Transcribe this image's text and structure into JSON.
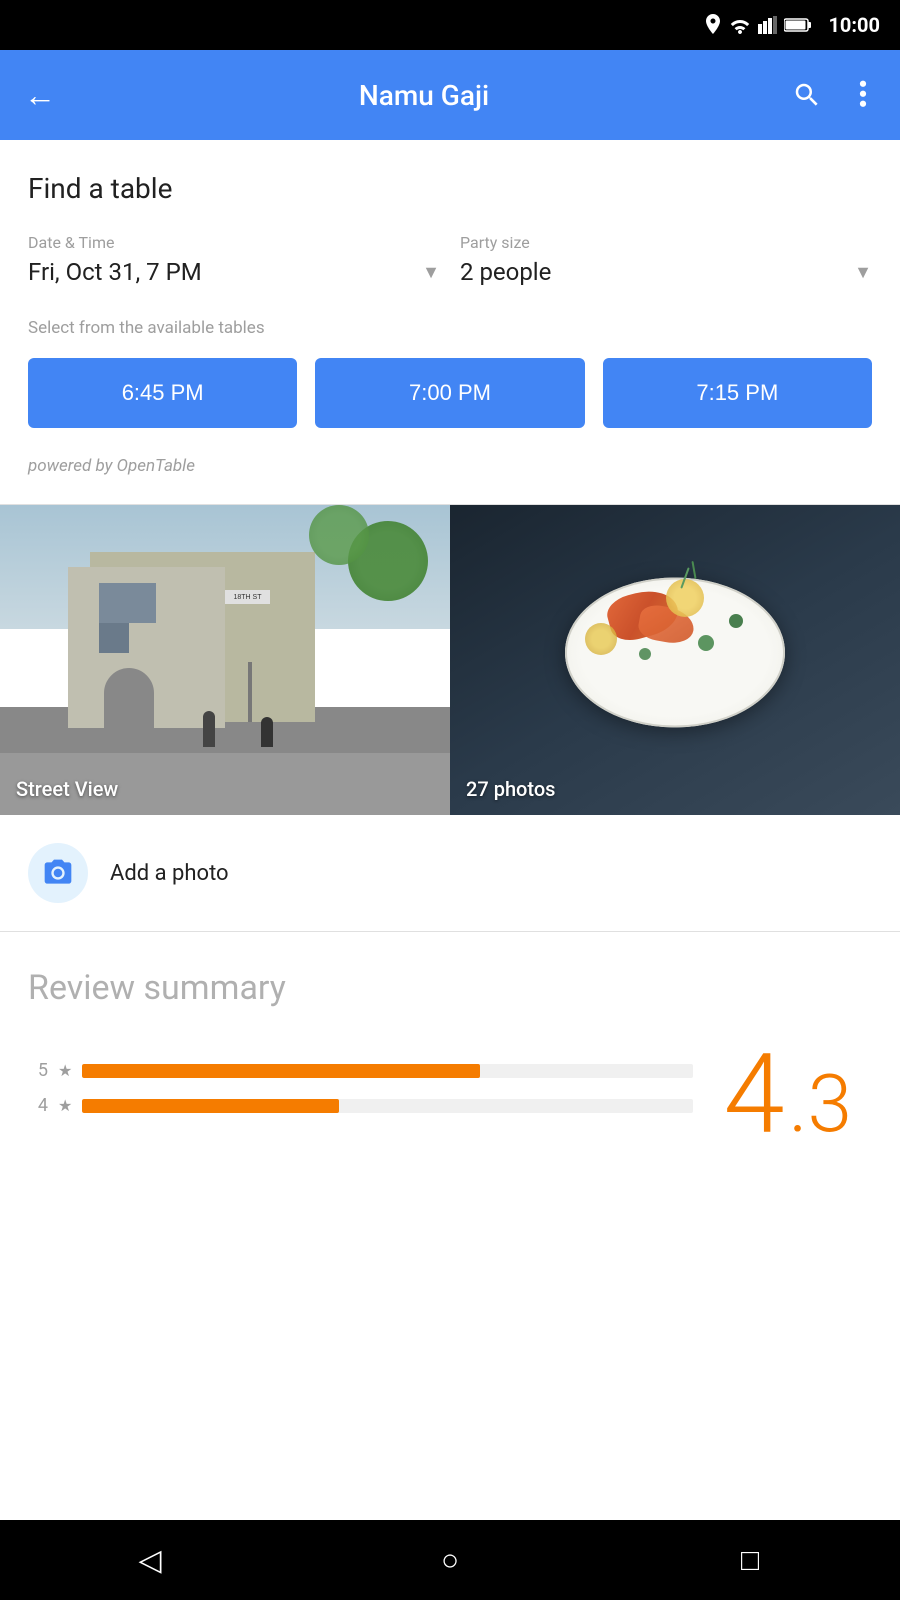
{
  "statusBar": {
    "time": "10:00"
  },
  "appBar": {
    "title": "Namu Gaji",
    "backLabel": "←",
    "searchLabel": "🔍",
    "moreLabel": "⋮"
  },
  "findTable": {
    "sectionTitle": "Find a table",
    "dateTimeLabel": "Date & Time",
    "dateTimeValue": "Fri, Oct 31, 7 PM",
    "partySizeLabel": "Party size",
    "partySizeValue": "2 people",
    "availableTablesLabel": "Select from the available tables",
    "timeSlots": [
      {
        "label": "6:45 PM"
      },
      {
        "label": "7:00 PM"
      },
      {
        "label": "7:15 PM"
      }
    ],
    "poweredBy": "powered by OpenTable"
  },
  "photos": {
    "streetViewLabel": "Street View",
    "photosLabel": "27 photos"
  },
  "addPhoto": {
    "label": "Add a photo"
  },
  "reviewSummary": {
    "title": "Review summary",
    "bigRatingWhole": "4",
    "bigRatingDecimal": ".3",
    "bars": [
      {
        "stars": "5",
        "widthPct": 65
      },
      {
        "stars": "4",
        "widthPct": 42
      }
    ]
  },
  "bottomNav": {
    "backIcon": "◁",
    "homeIcon": "○",
    "recentIcon": "□"
  }
}
